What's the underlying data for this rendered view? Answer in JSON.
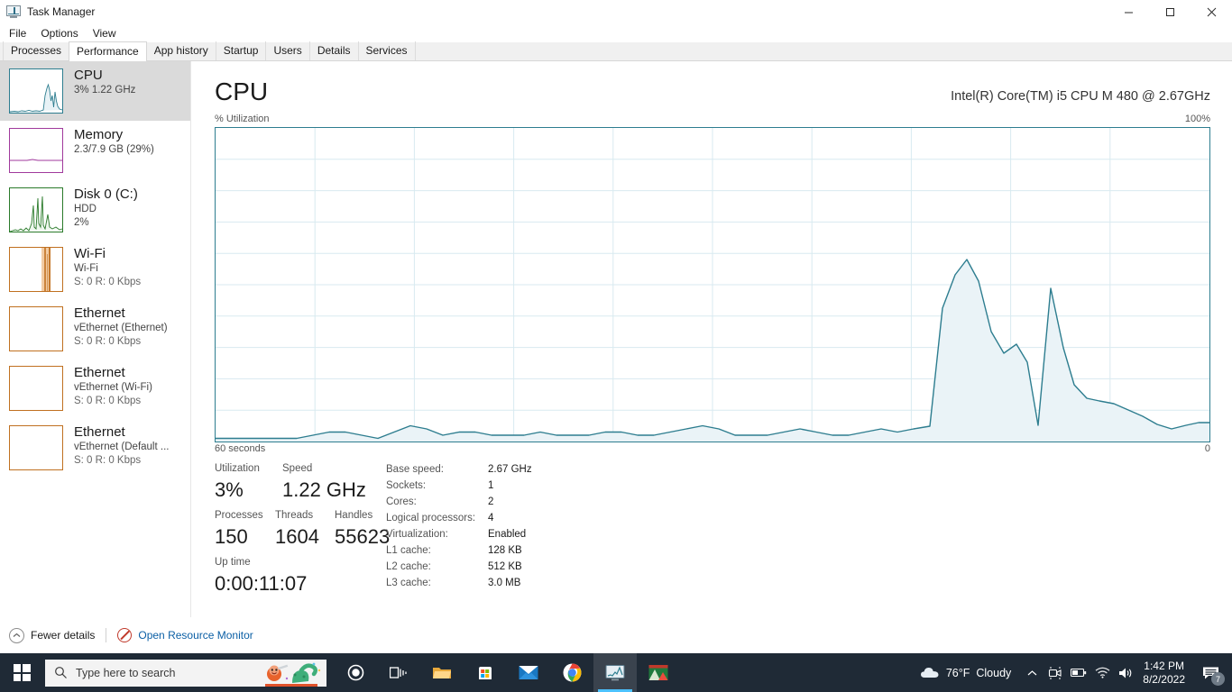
{
  "window": {
    "title": "Task Manager",
    "icon": "task-manager-icon",
    "controls": {
      "minimize": "Minimize",
      "maximize": "Maximize",
      "close": "Close"
    }
  },
  "menubar": {
    "items": [
      "File",
      "Options",
      "View"
    ]
  },
  "tabs": {
    "active": "Performance",
    "items": [
      "Processes",
      "Performance",
      "App history",
      "Startup",
      "Users",
      "Details",
      "Services"
    ]
  },
  "sidebar": {
    "items": [
      {
        "title": "CPU",
        "sub1": "3%  1.22 GHz",
        "sub2": "",
        "selected": true,
        "color": "#2d7d8f",
        "fill": "#e8f2f6"
      },
      {
        "title": "Memory",
        "sub1": "2.3/7.9 GB (29%)",
        "sub2": "",
        "selected": false,
        "color": "#a0399c",
        "fill": "#f8edf7"
      },
      {
        "title": "Disk 0 (C:)",
        "sub1": "HDD",
        "sub2": "2%",
        "selected": false,
        "color": "#2a7a2a",
        "fill": "#eef7ee"
      },
      {
        "title": "Wi-Fi",
        "sub1": "Wi-Fi",
        "sub2": "S: 0 R: 0 Kbps",
        "selected": false,
        "color": "#c07020",
        "fill": "#fdf3e8"
      },
      {
        "title": "Ethernet",
        "sub1": "vEthernet (Ethernet)",
        "sub2": "S: 0 R: 0 Kbps",
        "selected": false,
        "color": "#c07020",
        "fill": "#ffffff"
      },
      {
        "title": "Ethernet",
        "sub1": "vEthernet (Wi-Fi)",
        "sub2": "S: 0 R: 0 Kbps",
        "selected": false,
        "color": "#c07020",
        "fill": "#ffffff"
      },
      {
        "title": "Ethernet",
        "sub1": "vEthernet (Default ...",
        "sub2": "S: 0 R: 0 Kbps",
        "selected": false,
        "color": "#c07020",
        "fill": "#ffffff"
      }
    ]
  },
  "panel": {
    "heading": "CPU",
    "cpu_name": "Intel(R) Core(TM) i5 CPU M 480 @ 2.67GHz",
    "graph_top_left_label": "% Utilization",
    "graph_top_right_label": "100%",
    "graph_bottom_left_label": "60 seconds",
    "graph_bottom_right_label": "0"
  },
  "chart_data": {
    "type": "area",
    "title": "% Utilization",
    "xlabel": "60 seconds",
    "ylabel": "% Utilization",
    "ylim": [
      0,
      100
    ],
    "xlim": [
      60,
      0
    ],
    "grid": true,
    "grid_columns": 10,
    "grid_rows": 10,
    "line_color": "#2d7d8f",
    "fill_color": "#eaf3f7",
    "x": [
      60,
      59,
      58,
      57,
      56,
      55,
      54,
      53,
      52,
      51,
      50,
      49,
      48,
      47,
      46,
      45,
      44,
      43,
      42,
      41,
      40,
      39,
      38,
      37,
      36,
      35,
      34,
      33,
      32,
      31,
      30,
      29,
      28,
      27,
      26,
      25,
      24,
      23,
      22,
      21,
      20,
      19,
      18,
      17,
      16,
      15,
      14,
      13,
      12,
      11,
      10,
      9,
      8,
      7,
      6,
      5,
      4,
      3,
      2,
      1,
      0
    ],
    "values": [
      1,
      1,
      1,
      1,
      1,
      1,
      1,
      2,
      3,
      3,
      2,
      1,
      1,
      2,
      4,
      5,
      4,
      2,
      2,
      3,
      3,
      2,
      2,
      2,
      2,
      2,
      3,
      3,
      2,
      2,
      2,
      2,
      2,
      2,
      2,
      3,
      4,
      5,
      4,
      2,
      2,
      2,
      3,
      3,
      2,
      2,
      4,
      41,
      52,
      57,
      50,
      34,
      27,
      30,
      24,
      17,
      4,
      22,
      48,
      30,
      17,
      13,
      12,
      11,
      10,
      10,
      9,
      8,
      6,
      5,
      3,
      2,
      4
    ],
    "series": [
      {
        "name": "CPU utilization",
        "points": [
          {
            "t": 60,
            "v": 1
          },
          {
            "t": 55,
            "v": 1
          },
          {
            "t": 52,
            "v": 3
          },
          {
            "t": 49,
            "v": 1
          },
          {
            "t": 46,
            "v": 5
          },
          {
            "t": 43,
            "v": 2
          },
          {
            "t": 40,
            "v": 3
          },
          {
            "t": 34,
            "v": 2
          },
          {
            "t": 28,
            "v": 2
          },
          {
            "t": 24,
            "v": 5
          },
          {
            "t": 20,
            "v": 2
          },
          {
            "t": 17,
            "v": 3
          },
          {
            "t": 14,
            "v": 2
          },
          {
            "t": 13,
            "v": 4
          },
          {
            "t": 12.5,
            "v": 41
          },
          {
            "t": 12,
            "v": 52
          },
          {
            "t": 11.4,
            "v": 57
          },
          {
            "t": 11,
            "v": 50
          },
          {
            "t": 10.4,
            "v": 34
          },
          {
            "t": 10,
            "v": 27
          },
          {
            "t": 9.4,
            "v": 30
          },
          {
            "t": 8.6,
            "v": 20
          },
          {
            "t": 8,
            "v": 4
          },
          {
            "t": 7.4,
            "v": 48
          },
          {
            "t": 6.8,
            "v": 30
          },
          {
            "t": 6.2,
            "v": 17
          },
          {
            "t": 5.4,
            "v": 12
          },
          {
            "t": 4,
            "v": 11
          },
          {
            "t": 2.6,
            "v": 8
          },
          {
            "t": 1.6,
            "v": 5
          },
          {
            "t": 0.8,
            "v": 3
          },
          {
            "t": 0,
            "v": 4
          }
        ]
      }
    ]
  },
  "stats": {
    "utilization": {
      "label": "Utilization",
      "value": "3%"
    },
    "speed": {
      "label": "Speed",
      "value": "1.22 GHz"
    },
    "processes": {
      "label": "Processes",
      "value": "150"
    },
    "threads": {
      "label": "Threads",
      "value": "1604"
    },
    "handles": {
      "label": "Handles",
      "value": "55623"
    },
    "uptime": {
      "label": "Up time",
      "value": "0:00:11:07"
    },
    "specs": [
      {
        "key": "Base speed:",
        "value": "2.67 GHz"
      },
      {
        "key": "Sockets:",
        "value": "1"
      },
      {
        "key": "Cores:",
        "value": "2"
      },
      {
        "key": "Logical processors:",
        "value": "4"
      },
      {
        "key": "Virtualization:",
        "value": "Enabled"
      },
      {
        "key": "L1 cache:",
        "value": "128 KB"
      },
      {
        "key": "L2 cache:",
        "value": "512 KB"
      },
      {
        "key": "L3 cache:",
        "value": "3.0 MB"
      }
    ]
  },
  "statusbar": {
    "fewer_details": "Fewer details",
    "open_resource_monitor": "Open Resource Monitor",
    "link_color": "#0b5fa5"
  },
  "taskbar": {
    "start": "start-button",
    "search_placeholder": "Type here to search",
    "buttons": [
      "cortana-icon",
      "task-view-icon",
      "file-explorer-icon",
      "microsoft-store-icon",
      "mail-icon",
      "chrome-icon",
      "task-manager-icon",
      "photos-icon"
    ],
    "weather": {
      "temperature": "76°F",
      "condition": "Cloudy"
    },
    "clock": {
      "time": "1:42 PM",
      "date": "8/2/2022"
    },
    "notification_count": "7"
  }
}
